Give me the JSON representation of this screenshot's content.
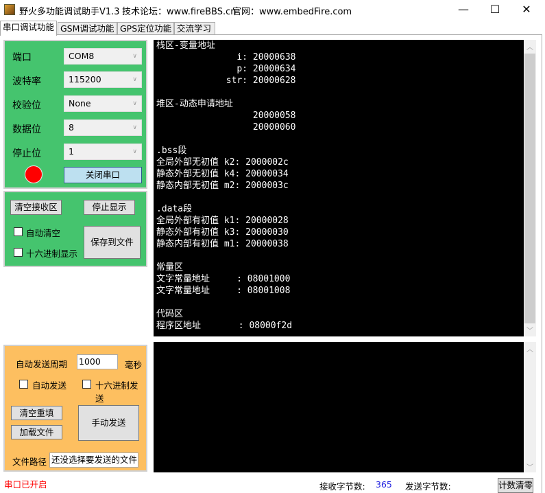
{
  "window": {
    "title": "野火多功能调试助手V1.3",
    "forum": "技术论坛：www.fireBBS.cn",
    "website": "官网：www.embedFire.com",
    "minimize": "—",
    "maximize": "☐",
    "close": "✕"
  },
  "tabs": [
    {
      "label": "串口调试功能",
      "active": true
    },
    {
      "label": "GSM调试功能"
    },
    {
      "label": "GPS定位功能"
    },
    {
      "label": "交流学习"
    }
  ],
  "serial": {
    "port_label": "端口",
    "port_value": "COM8",
    "baud_label": "波特率",
    "baud_value": "115200",
    "parity_label": "校验位",
    "parity_value": "None",
    "databits_label": "数据位",
    "databits_value": "8",
    "stopbits_label": "停止位",
    "stopbits_value": "1",
    "status_led_color": "#ff0000",
    "close_port": "关闭串口"
  },
  "receive": {
    "clear": "清空接收区",
    "stop_display": "停止显示",
    "auto_clear": "自动清空",
    "hex_display": "十六进制显示",
    "save_to_file": "保存到文件"
  },
  "send": {
    "period_label": "自动发送周期",
    "period_value": "1000",
    "period_unit": "毫秒",
    "auto_send": "自动发送",
    "hex_send": "十六进制发送",
    "clear_refill": "清空重填",
    "load_file": "加载文件",
    "manual_send": "手动发送",
    "file_path_label": "文件路径",
    "file_path_value": "还没选择要发送的文件"
  },
  "receive_lines": [
    "栈区-变量地址",
    "               i: 20000638",
    "               p: 20000634",
    "             str: 20000628",
    "",
    "堆区-动态申请地址",
    "                  20000058",
    "                  20000060",
    "",
    ".bss段",
    "全局外部无初值 k2: 2000002c",
    "静态外部无初值 k4: 20000034",
    "静态内部无初值 m2: 2000003c",
    "",
    ".data段",
    "全局外部有初值 k1: 20000028",
    "静态外部有初值 k3: 20000030",
    "静态内部有初值 m1: 20000038",
    "",
    "常量区",
    "文字常量地址     : 08001000",
    "文字常量地址     : 08001008",
    "",
    "代码区",
    "程序区地址       : 08000f2d"
  ],
  "status": {
    "port_status": "串口已开启",
    "rx_label": "接收字节数:",
    "rx_count": "365",
    "tx_label": "发送字节数:",
    "tx_count": "",
    "reset_counter": "计数清零"
  }
}
